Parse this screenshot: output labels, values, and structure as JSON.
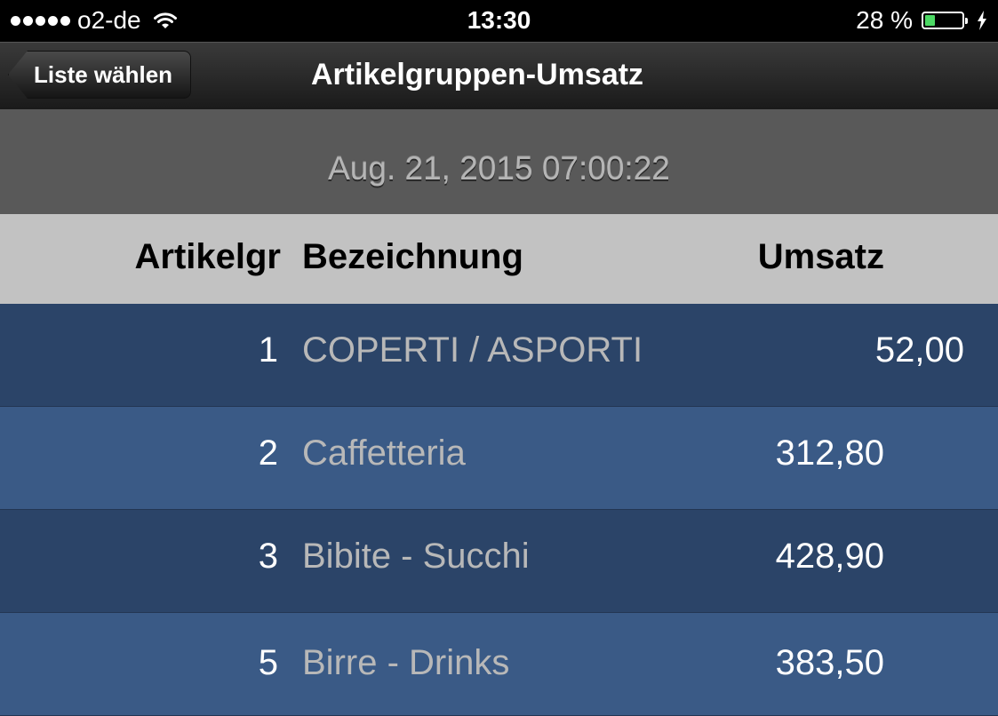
{
  "status_bar": {
    "carrier": "o2-de",
    "time": "13:30",
    "battery_text": "28 %",
    "battery_level": 0.28,
    "battery_color": "#4cd964"
  },
  "nav": {
    "back_label": "Liste wählen",
    "title": "Artikelgruppen-Umsatz"
  },
  "report": {
    "timestamp": "Aug. 21, 2015 07:00:22"
  },
  "table": {
    "columns": [
      "Artikelgr",
      "Bezeichnung",
      "Umsatz"
    ],
    "rows": [
      {
        "num": "1",
        "name": "COPERTI / ASPORTI",
        "value": "52,00"
      },
      {
        "num": "2",
        "name": "Caffetteria",
        "value": "312,80"
      },
      {
        "num": "3",
        "name": "Bibite - Succhi",
        "value": "428,90"
      },
      {
        "num": "5",
        "name": "Birre - Drinks",
        "value": "383,50"
      }
    ]
  },
  "icons": [
    "signal-dots-icon",
    "wifi-icon",
    "battery-icon",
    "charging-bolt-icon",
    "back-chevron-icon"
  ]
}
